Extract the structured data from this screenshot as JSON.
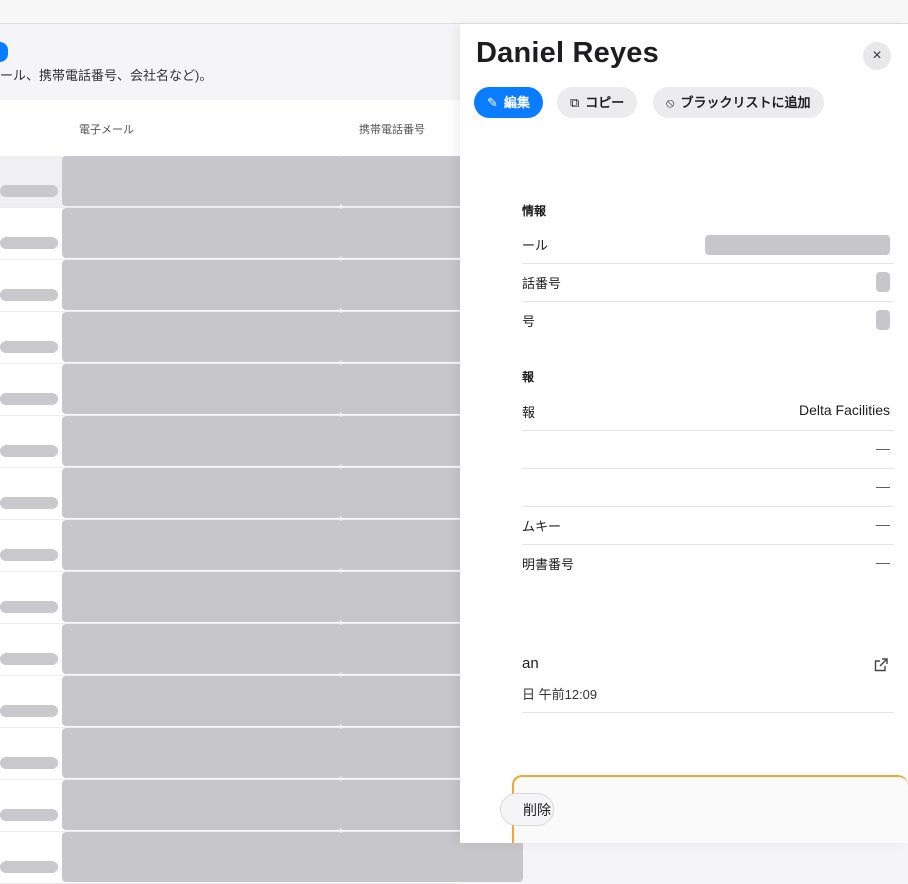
{
  "left": {
    "hint": "ール、携帯電話番号、会社名など)。",
    "columns": [
      "電子メール",
      "携帯電話番号"
    ]
  },
  "detail": {
    "name": "Daniel Reyes",
    "close_label": "×",
    "buttons": {
      "edit": "編集",
      "copy": "コピー",
      "blacklist": "ブラックリストに追加"
    },
    "contact_section": "情報",
    "contact_fields": [
      "ール",
      "話番号",
      "号"
    ],
    "company_section": "報",
    "company_fields": [
      {
        "label": "報",
        "value": "Delta Facilities"
      },
      {
        "label": "",
        "value": "—"
      },
      {
        "label": "",
        "value": "—"
      },
      {
        "label": "ムキー",
        "value": "—"
      },
      {
        "label": "明書番号",
        "value": "—"
      }
    ],
    "link_text": "an",
    "timestamp": "日 午前12:09",
    "delete_label": "削除"
  },
  "colors": {
    "accent": "#0a7cff",
    "redaction": "#c7c7cb",
    "focus": "#f6a534"
  }
}
